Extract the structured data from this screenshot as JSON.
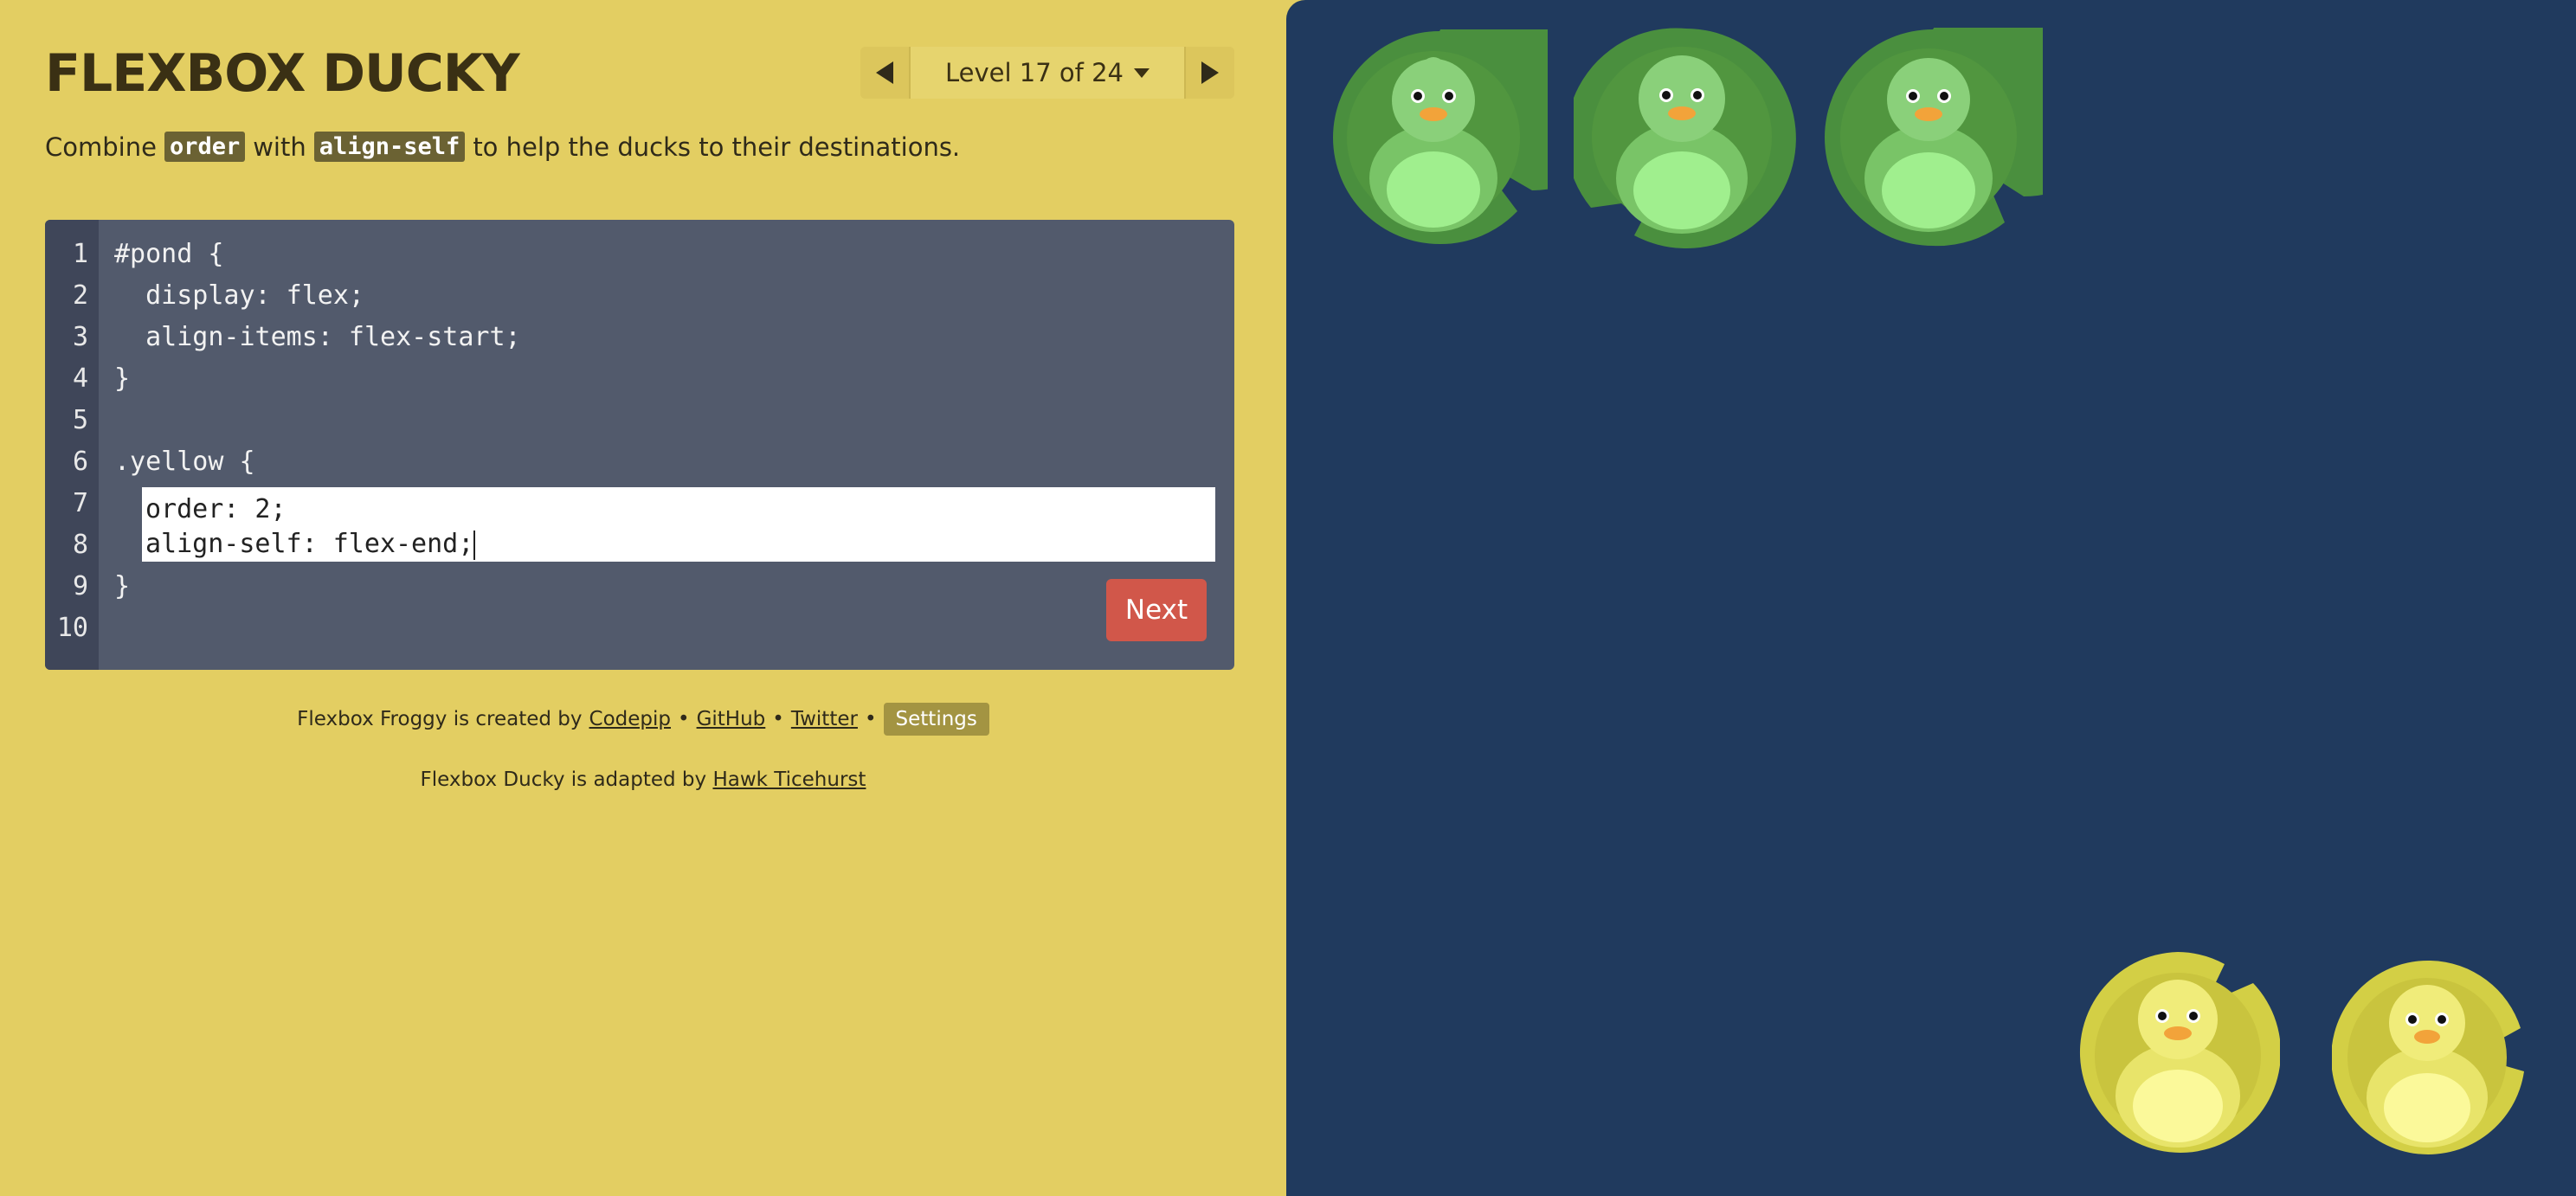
{
  "title": "FLEXBOX DUCKY",
  "level_nav": {
    "label": "Level 17 of 24"
  },
  "instructions": {
    "before": "Combine",
    "code1": "order",
    "middle": "with",
    "code2": "align-self",
    "after": "to help the ducks to their destinations."
  },
  "editor": {
    "line_numbers": [
      "1",
      "2",
      "3",
      "4",
      "5",
      "6",
      "7",
      "8",
      "9",
      "10"
    ],
    "lines": {
      "l1": "#pond {",
      "l2": "  display: flex;",
      "l3": "  align-items: flex-start;",
      "l4": "}",
      "l6": ".yellow {",
      "l9": "}"
    },
    "input_lines": [
      "order: 2;",
      "align-self: flex-end;"
    ],
    "next_label": "Next"
  },
  "footer": {
    "created_prefix": "Flexbox Froggy is created by",
    "codepip": "Codepip",
    "sep": "•",
    "github": "GitHub",
    "twitter": "Twitter",
    "settings": "Settings",
    "adapted_prefix": "Flexbox Ducky is adapted by",
    "author": "Hawk Ticehurst"
  },
  "pond": {
    "green_count": 3,
    "yellow_count": 2,
    "colors": {
      "water": "#203a5e",
      "green_pad": "#4a8f3e",
      "green_duck": "#8ad07a",
      "yellow_pad": "#d3cf45",
      "yellow_duck": "#f0ec7a"
    }
  }
}
